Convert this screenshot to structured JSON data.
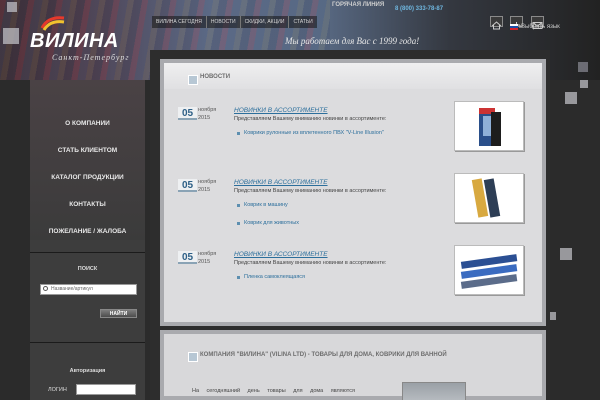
{
  "header": {
    "logo_text": "ВИЛИНА",
    "logo_sub": "Санкт-Петербург",
    "nav": [
      "ВИЛИНА СЕГОДНЯ",
      "НОВОСТИ",
      "СКИДКИ, АКЦИИ",
      "СТАТЬИ"
    ],
    "hotline_label": "ГОРЯЧАЯ ЛИНИЯ",
    "phone": "8 (800) 333-78-87",
    "language_label": "Выбрать язык",
    "slogan": "Мы работаем для Вас с 1999 года!"
  },
  "sidebar": {
    "menu": [
      "О КОМПАНИИ",
      "СТАТЬ КЛИЕНТОМ",
      "КАТАЛОГ ПРОДУКЦИИ",
      "КОНТАКТЫ",
      "ПОЖЕЛАНИЕ / ЖАЛОБА"
    ],
    "search_title": "ПОИСК",
    "search_placeholder": "Название/артикул",
    "search_button": "НАЙТИ",
    "auth_title": "Авторизация",
    "login_label": "логин"
  },
  "news": {
    "title": "НОВОСТИ",
    "items": [
      {
        "day": "05",
        "month": "ноября",
        "year": "2015",
        "title": "НОВИНКИ В АССОРТИМЕНТЕ",
        "intro": "Представляем Вашему вниманию новинки в ассортименте:",
        "links": [
          "Коврики рулонные из вплетенного ПВХ \"V-Line Illusion\""
        ]
      },
      {
        "day": "05",
        "month": "ноября",
        "year": "2015",
        "title": "НОВИНКИ В АССОРТИМЕНТЕ",
        "intro": "Представляем Вашему вниманию новинки в ассортименте:",
        "links": [
          "Коврик в машину",
          "Коврик для животных"
        ]
      },
      {
        "day": "05",
        "month": "ноября",
        "year": "2015",
        "title": "НОВИНКИ В АССОРТИМЕНТЕ",
        "intro": "Представляем Вашему вниманию новинки в ассортименте:",
        "links": [
          "Пленка самоклеящаяся"
        ]
      }
    ]
  },
  "company": {
    "title": "КОМПАНИЯ \"ВИЛИНА\" (VILINA LTD) - ТОВАРЫ ДЛЯ ДОМА, КОВРИКИ ДЛЯ ВАННОЙ",
    "text": "На сегодняшний день товары для дома являются"
  }
}
